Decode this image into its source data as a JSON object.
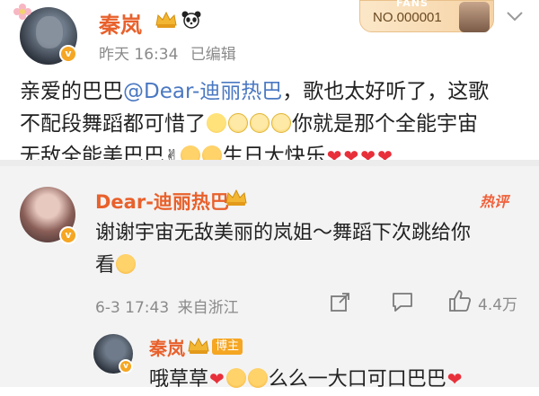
{
  "post": {
    "author": "秦岚",
    "time": "昨天 16:34",
    "edited": "已编辑",
    "fan_badge": {
      "label": "FANS",
      "number": "NO.000001"
    },
    "text_prefix": "亲爱的巴巴",
    "mention": "@Dear-迪丽热巴",
    "text_line1_rest": "，歌也太好听了，这歌",
    "text_line2_a": "不配段舞蹈都可惜了",
    "text_line2_b": "你就是那个全能宇宙",
    "text_line3_a": "无敌全能美巴巴",
    "text_line3_b": "生日大快乐"
  },
  "comment": {
    "author": "Dear-迪丽热巴",
    "hot_label": "热评",
    "text_line1": "谢谢宇宙无敌美丽的岚姐～舞蹈下次跳给你",
    "text_line2": "看",
    "time": "6-3 17:43",
    "source": "来自浙江",
    "like_count": "4.4万"
  },
  "reply": {
    "author": "秦岚",
    "blogger_badge": "博主",
    "text_a": "哦草草",
    "text_b": "么么一大口可口巴巴"
  },
  "icons": {
    "crown": "vip-crown-icon",
    "panda": "panda-emoji-icon",
    "chevron": "chevron-down-icon",
    "share": "share-icon",
    "comment": "comment-icon",
    "like": "like-icon"
  },
  "colors": {
    "name": "#e8612c",
    "mention": "#4a78c2",
    "heart": "#e8303a",
    "verified": "#f5a623"
  }
}
